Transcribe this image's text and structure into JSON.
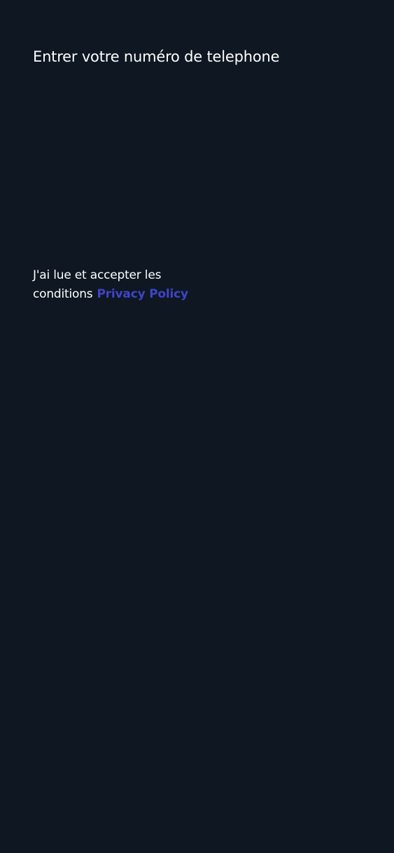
{
  "colors": {
    "background": "#0e1722",
    "text": "#ffffff",
    "accent": "#4044c6"
  },
  "page": {
    "title": "Entrer votre numéro de telephone"
  },
  "terms": {
    "line1": "J'ai lue et accepter les",
    "line2": "conditions",
    "link_label": "Privacy Policy"
  }
}
